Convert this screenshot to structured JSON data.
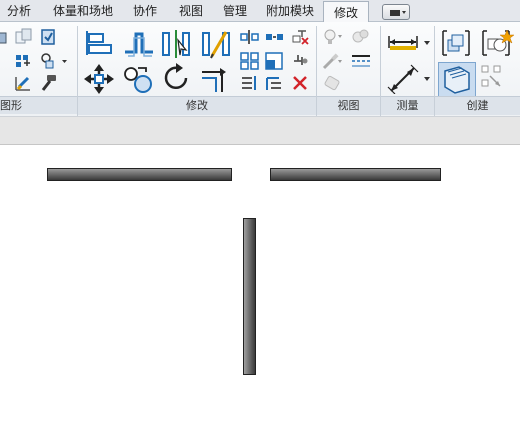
{
  "tabs": [
    {
      "label": "分析"
    },
    {
      "label": "体量和场地"
    },
    {
      "label": "协作"
    },
    {
      "label": "视图"
    },
    {
      "label": "管理"
    },
    {
      "label": "附加模块"
    },
    {
      "label": "修改"
    }
  ],
  "panels": {
    "geometry_partial": "图形",
    "modify": "修改",
    "view": "视图",
    "measure": "测量",
    "create": "创建"
  },
  "icons": [
    "cut-geometry-icon",
    "join-icon",
    "paint-icon",
    "split-face-icon",
    "wall-join-icon",
    "demolish-icon",
    "align-icon",
    "offset-icon",
    "mirror-axis-icon",
    "mirror-draw-icon",
    "move-icon",
    "copy-icon",
    "rotate-icon",
    "trim-extend-icon",
    "split-icon",
    "array-icon",
    "scale-icon",
    "pin-icon",
    "unpin-icon",
    "delete-icon",
    "hide-bulb-icon",
    "override-graphics-icon",
    "linework-icon",
    "measure-distance-icon",
    "dimension-icon",
    "create-assembly-icon",
    "create-parts-icon",
    "create-group-icon",
    "similar-icon"
  ],
  "colors": {
    "accent_blue": "#1f6fb8",
    "active_tab_bg": "#f7f8fa",
    "delete_red": "#d2232a",
    "wall_dark": "#3a3a3a"
  },
  "canvas": {
    "elements": [
      "wall-horizontal-left",
      "wall-horizontal-right",
      "wall-vertical"
    ]
  }
}
